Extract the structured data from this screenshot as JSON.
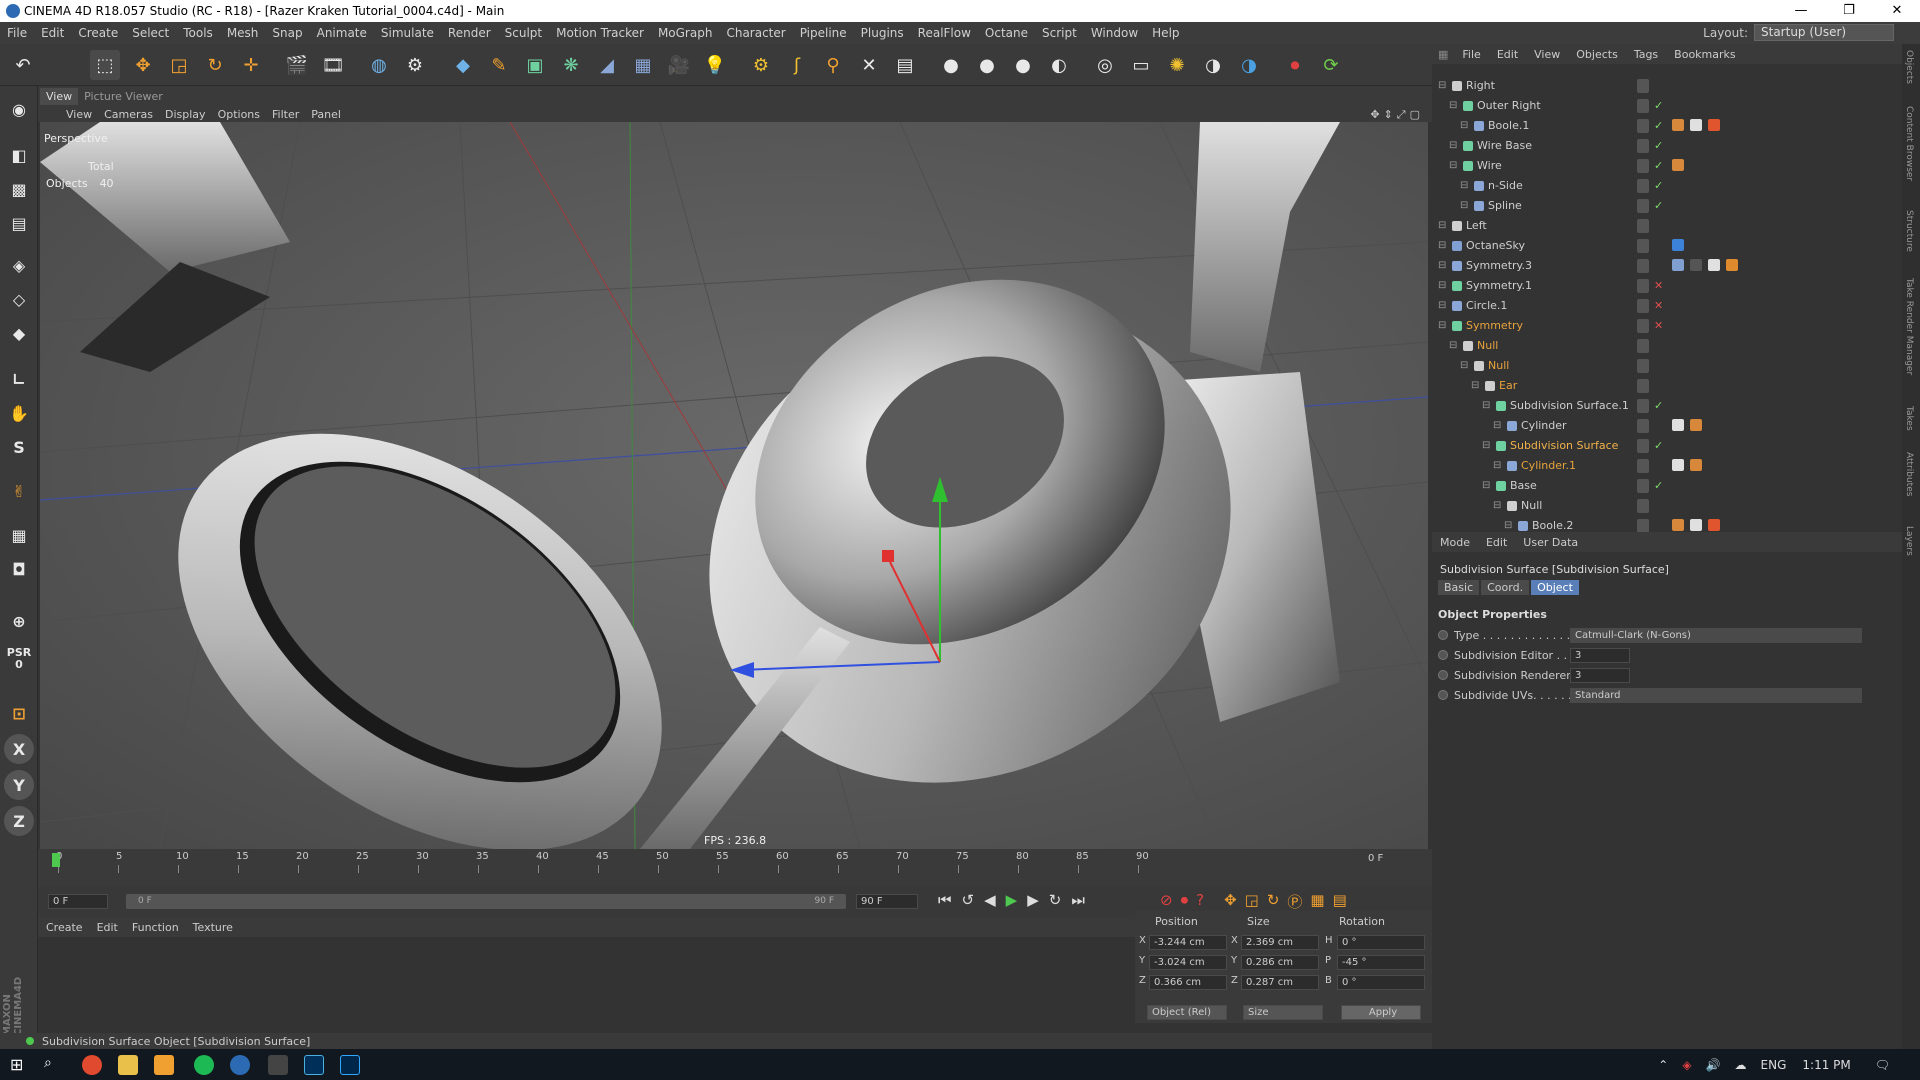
{
  "window": {
    "title": "CINEMA 4D R18.057 Studio (RC - R18) - [Razer Kraken Tutorial_0004.c4d] - Main",
    "minimize": "—",
    "restore": "❐",
    "close": "✕"
  },
  "menubar": [
    "File",
    "Edit",
    "Create",
    "Select",
    "Tools",
    "Mesh",
    "Snap",
    "Animate",
    "Simulate",
    "Render",
    "Sculpt",
    "Motion Tracker",
    "MoGraph",
    "Character",
    "Pipeline",
    "Plugins",
    "RealFlow",
    "Octane",
    "Script",
    "Window",
    "Help"
  ],
  "layout": {
    "label": "Layout:",
    "value": "Startup (User)"
  },
  "viewport": {
    "tabs": [
      "View",
      "Picture Viewer"
    ],
    "menu": [
      "View",
      "Cameras",
      "Display",
      "Options",
      "Filter",
      "Panel"
    ],
    "label": "Perspective",
    "stats_header": "Total",
    "objects_label": "Objects",
    "objects_count": "40",
    "fps": "FPS : 236.8"
  },
  "left_toolbar": {
    "psr": "PSR",
    "psr_value": "0",
    "x": "X",
    "y": "Y",
    "z": "Z"
  },
  "timeline": {
    "ticks": [
      "0",
      "5",
      "10",
      "15",
      "20",
      "25",
      "30",
      "35",
      "40",
      "45",
      "50",
      "55",
      "60",
      "65",
      "70",
      "75",
      "80",
      "85",
      "90"
    ],
    "current_frame": "0 F",
    "start_field": "0 F",
    "range_start": "0 F",
    "range_end": "90 F",
    "end_field": "90 F"
  },
  "material_menu": [
    "Create",
    "Edit",
    "Function",
    "Texture"
  ],
  "coords": {
    "headers": [
      "Position",
      "Size",
      "Rotation"
    ],
    "rows": [
      {
        "axis": "X",
        "pos": "-3.244 cm",
        "size_axis": "X",
        "size": "2.369 cm",
        "rot_axis": "H",
        "rot": "0 °"
      },
      {
        "axis": "Y",
        "pos": "-3.024 cm",
        "size_axis": "Y",
        "size": "0.286 cm",
        "rot_axis": "P",
        "rot": "-45 °"
      },
      {
        "axis": "Z",
        "pos": "0.366 cm",
        "size_axis": "Z",
        "size": "0.287 cm",
        "rot_axis": "B",
        "rot": "0 °"
      }
    ],
    "mode": "Object (Rel)",
    "size_mode": "Size",
    "apply": "Apply"
  },
  "status": "Subdivision Surface Object [Subdivision Surface]",
  "object_manager": {
    "menu": [
      "File",
      "Edit",
      "View",
      "Objects",
      "Tags",
      "Bookmarks"
    ],
    "rows": [
      {
        "name": "Right",
        "indent": 0,
        "style": "normal",
        "check": "",
        "icon": "#cfcfcf",
        "tags": []
      },
      {
        "name": "Outer Right",
        "indent": 1,
        "style": "normal",
        "check": "✓",
        "icon": "#6fd0a0",
        "tags": []
      },
      {
        "name": "Boole.1",
        "indent": 2,
        "style": "normal",
        "check": "✓",
        "icon": "#8aa7d8",
        "tags": [
          "#d8883a",
          "#e0e0e0",
          "#e0552e"
        ]
      },
      {
        "name": "Wire Base",
        "indent": 1,
        "style": "normal",
        "check": "✓",
        "icon": "#6fd0a0",
        "tags": []
      },
      {
        "name": "Wire",
        "indent": 1,
        "style": "normal",
        "check": "✓",
        "icon": "#6fd0a0",
        "tags": [
          "#d8883a"
        ]
      },
      {
        "name": "n-Side",
        "indent": 2,
        "style": "normal",
        "check": "✓",
        "icon": "#8aa7d8",
        "tags": []
      },
      {
        "name": "Spline",
        "indent": 2,
        "style": "normal",
        "check": "✓",
        "icon": "#8aa7d8",
        "tags": []
      },
      {
        "name": "Left",
        "indent": 0,
        "style": "normal",
        "check": "",
        "icon": "#cfcfcf",
        "tags": []
      },
      {
        "name": "OctaneSky",
        "indent": 0,
        "style": "normal",
        "check": "",
        "icon": "#7fa0d0",
        "tags": [
          "#3b82d8"
        ]
      },
      {
        "name": "Symmetry.3",
        "indent": 0,
        "style": "normal",
        "check": "",
        "icon": "#8aa7d8",
        "tags": [
          "#7fa0d0",
          "#555",
          "#e0e0e0",
          "#e08a2e"
        ]
      },
      {
        "name": "Symmetry.1",
        "indent": 0,
        "style": "normal",
        "check": "✕",
        "icon": "#6fd0a0",
        "tags": []
      },
      {
        "name": "Circle.1",
        "indent": 0,
        "style": "normal",
        "check": "✕",
        "icon": "#8aa7d8",
        "tags": []
      },
      {
        "name": "Symmetry",
        "indent": 0,
        "style": "orange",
        "check": "✕",
        "icon": "#6fd0a0",
        "tags": []
      },
      {
        "name": "Null",
        "indent": 1,
        "style": "orange",
        "check": "",
        "icon": "#cfcfcf",
        "tags": []
      },
      {
        "name": "Null",
        "indent": 2,
        "style": "orange",
        "check": "",
        "icon": "#cfcfcf",
        "tags": []
      },
      {
        "name": "Ear",
        "indent": 3,
        "style": "orange",
        "check": "",
        "icon": "#cfcfcf",
        "tags": []
      },
      {
        "name": "Subdivision Surface.1",
        "indent": 4,
        "style": "normal",
        "check": "✓",
        "icon": "#6fd0a0",
        "tags": []
      },
      {
        "name": "Cylinder",
        "indent": 5,
        "style": "normal",
        "check": "",
        "icon": "#8aa7d8",
        "tags": [
          "#e0e0e0",
          "#d8883a"
        ]
      },
      {
        "name": "Subdivision Surface",
        "indent": 4,
        "style": "sel",
        "check": "✓",
        "icon": "#6fd0a0",
        "tags": []
      },
      {
        "name": "Cylinder.1",
        "indent": 5,
        "style": "orange",
        "check": "",
        "icon": "#8aa7d8",
        "tags": [
          "#e0e0e0",
          "#d8883a"
        ]
      },
      {
        "name": "Base",
        "indent": 4,
        "style": "normal",
        "check": "✓",
        "icon": "#6fd0a0",
        "tags": []
      },
      {
        "name": "Null",
        "indent": 5,
        "style": "normal",
        "check": "",
        "icon": "#cfcfcf",
        "tags": []
      },
      {
        "name": "Boole.2",
        "indent": 6,
        "style": "normal",
        "check": "",
        "icon": "#8aa7d8",
        "tags": [
          "#d8883a",
          "#e0e0e0",
          "#e0552e"
        ]
      }
    ]
  },
  "attribute_manager": {
    "menu": [
      "Mode",
      "Edit",
      "User Data"
    ],
    "title": "Subdivision Surface [Subdivision Surface]",
    "tabs": [
      "Basic",
      "Coord.",
      "Object"
    ],
    "section": "Object Properties",
    "props": [
      {
        "label": "Type . . . . . . . . . . . . .",
        "value": "Catmull-Clark (N-Gons)",
        "kind": "dropdown"
      },
      {
        "label": "Subdivision Editor . .",
        "value": "3",
        "kind": "number"
      },
      {
        "label": "Subdivision Renderer",
        "value": "3",
        "kind": "number"
      },
      {
        "label": "Subdivide UVs. . . . . .",
        "value": "Standard",
        "kind": "dropdown"
      }
    ]
  },
  "right_strip": [
    "Objects",
    "Content Browser",
    "Structure",
    "Take Render Manager",
    "Takes",
    "Attributes",
    "Layers"
  ],
  "taskbar": {
    "lang": "ENG",
    "time": "1:11 PM"
  }
}
